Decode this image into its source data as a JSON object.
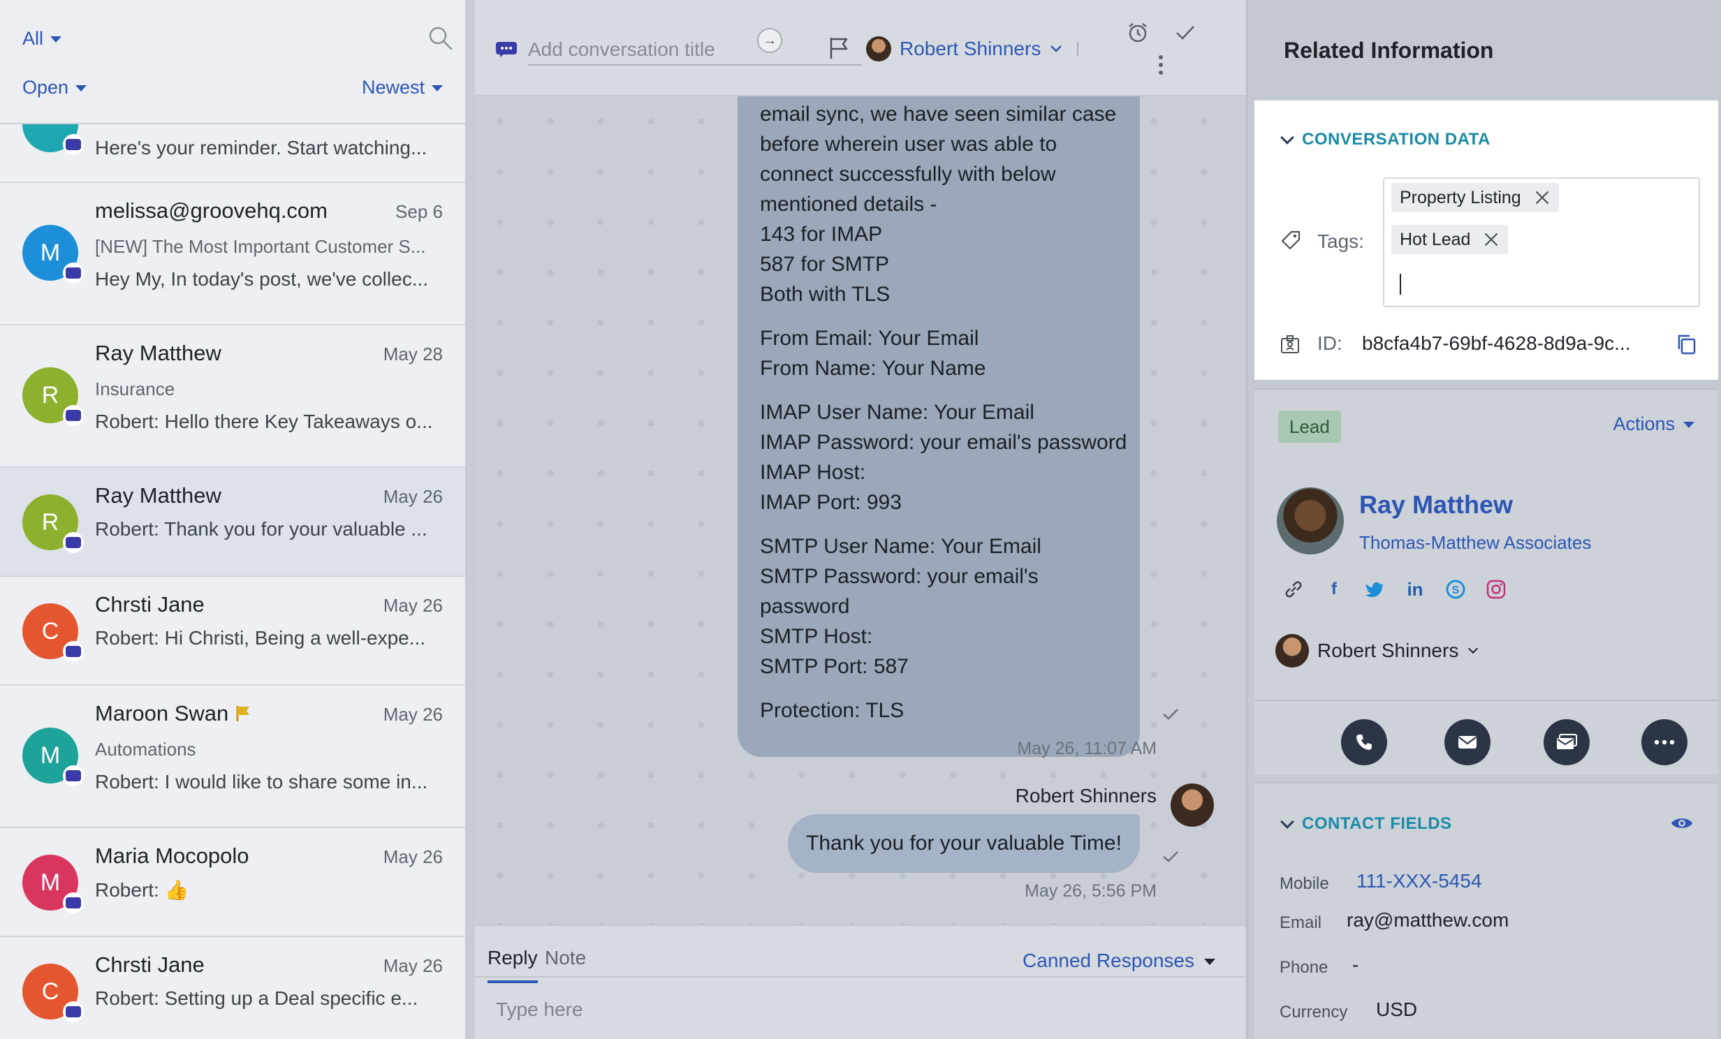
{
  "list_header": {
    "filter_label": "All",
    "status_label": "Open",
    "sort_label": "Newest"
  },
  "conversations": [
    {
      "initial": "",
      "color": "#1ea7b0",
      "name": "",
      "date": "",
      "subject": "",
      "preview": "Here's your reminder. Start watching..."
    },
    {
      "initial": "M",
      "color": "#1d8fd8",
      "name": "melissa@groovehq.com",
      "date": "Sep 6",
      "subject": "[NEW] The Most Important Customer S...",
      "preview": "Hey My, In today's post, we've collec..."
    },
    {
      "initial": "R",
      "color": "#8db02e",
      "name": "Ray Matthew",
      "date": "May 28",
      "subject": "Insurance",
      "preview": "Robert: Hello there Key Takeaways o..."
    },
    {
      "initial": "R",
      "color": "#8db02e",
      "name": "Ray Matthew",
      "date": "May 26",
      "subject": "",
      "preview": "Robert: Thank you for your valuable ..."
    },
    {
      "initial": "C",
      "color": "#e4562f",
      "name": "Chrsti Jane",
      "date": "May 26",
      "subject": "",
      "preview": "Robert: Hi Christi, Being a well-expe..."
    },
    {
      "initial": "M",
      "color": "#1ea39a",
      "name": "Maroon Swan",
      "date": "May 26",
      "subject": "Automations",
      "preview": "Robert: I would like to share some in..."
    },
    {
      "initial": "M",
      "color": "#d9365f",
      "name": "Maria Mocopolo",
      "date": "May 26",
      "subject": "",
      "preview": "Robert: 👍"
    },
    {
      "initial": "C",
      "color": "#e4562f",
      "name": "Chrsti Jane",
      "date": "May 26",
      "subject": "",
      "preview": "Robert: Setting up a Deal specific e..."
    }
  ],
  "conversation": {
    "title_placeholder": "Add conversation title",
    "assignee": "Robert Shinners",
    "message_lines": [
      [
        "email sync, we have seen similar case",
        "before wherein user was able to",
        "connect successfully with below",
        "mentioned details -",
        "143 for IMAP",
        "587 for SMTP",
        "Both with TLS"
      ],
      [
        "From Email: Your Email",
        "From Name: Your Name"
      ],
      [
        "IMAP User Name: Your Email",
        "IMAP Password: your email's password",
        "IMAP Host:",
        "IMAP Port: 993"
      ],
      [
        "SMTP User Name: Your Email",
        "SMTP Password: your email's",
        "password",
        "SMTP Host:",
        "SMTP Port: 587"
      ],
      [
        "Protection: TLS"
      ]
    ],
    "timestamp_1": "May 26, 11:07 AM",
    "sender": "Robert Shinners",
    "reply_message": "Thank you for your valuable Time!",
    "timestamp_2": "May 26, 5:56 PM"
  },
  "compose": {
    "tab_reply": "Reply",
    "tab_note": "Note",
    "canned": "Canned Responses",
    "placeholder": "Type here"
  },
  "right_panel": {
    "title": "Related Information",
    "conv_data_heading": "CONVERSATION DATA",
    "tags_label": "Tags:",
    "tags": [
      "Property Listing",
      "Hot Lead"
    ],
    "id_label": "ID:",
    "id_value": "b8cfa4b7-69bf-4628-8d9a-9c..."
  },
  "contact": {
    "badge": "Lead",
    "actions_label": "Actions",
    "name": "Ray Matthew",
    "company": "Thomas-Matthew Associates",
    "owner": "Robert Shinners",
    "socials": [
      "link-icon",
      "facebook-icon",
      "twitter-icon",
      "linkedin-icon",
      "skype-icon",
      "instagram-icon"
    ]
  },
  "contact_fields": {
    "heading": "CONTACT FIELDS",
    "mobile_label": "Mobile",
    "mobile_value": "111-XXX-5454",
    "email_label": "Email",
    "email_value": "ray@matthew.com",
    "phone_label": "Phone",
    "phone_value": "-",
    "currency_label": "Currency",
    "currency_value": "USD"
  }
}
